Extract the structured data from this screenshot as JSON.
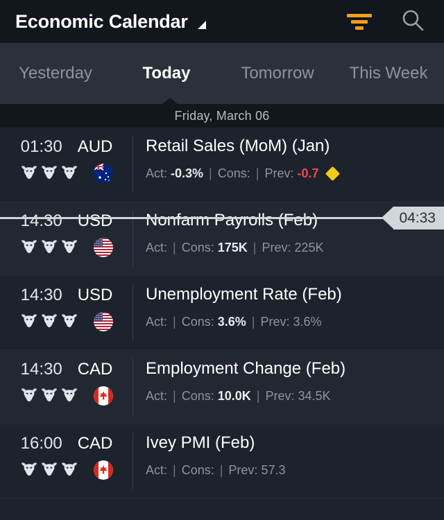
{
  "header": {
    "title": "Economic Calendar",
    "dropdown_icon": "triangle-caret-icon",
    "filter_icon": "filter-icon",
    "search_icon": "search-icon",
    "accent_color": "#f0a020"
  },
  "tabs": [
    {
      "label": "Yesterday",
      "active": false
    },
    {
      "label": "Today",
      "active": true
    },
    {
      "label": "Tomorrow",
      "active": false
    },
    {
      "label": "This Week",
      "active": false
    }
  ],
  "date_band": {
    "label": "Friday, March 06"
  },
  "now_marker": {
    "time": "04:33"
  },
  "labels": {
    "act": "Act:",
    "cons": "Cons:",
    "prev": "Prev:",
    "separator": "|"
  },
  "events": [
    {
      "time": "01:30",
      "currency": "AUD",
      "flag": "flag-australia",
      "impact_icons": 3,
      "title": "Retail Sales (MoM) (Jan)",
      "actual": "-0.3%",
      "actual_state": "normal",
      "consensus": "",
      "previous": "-0.7",
      "previous_state": "negative",
      "badge": "yellow-diamond-icon"
    },
    {
      "time": "14:30",
      "currency": "USD",
      "flag": "flag-usa",
      "impact_icons": 3,
      "title": "Nonfarm Payrolls (Feb)",
      "actual": "",
      "actual_state": "normal",
      "consensus": "175K",
      "previous": "225K",
      "previous_state": "dim",
      "badge": ""
    },
    {
      "time": "14:30",
      "currency": "USD",
      "flag": "flag-usa",
      "impact_icons": 3,
      "title": "Unemployment Rate (Feb)",
      "actual": "",
      "actual_state": "normal",
      "consensus": "3.6%",
      "previous": "3.6%",
      "previous_state": "dim",
      "badge": ""
    },
    {
      "time": "14:30",
      "currency": "CAD",
      "flag": "flag-canada",
      "impact_icons": 3,
      "title": "Employment Change (Feb)",
      "actual": "",
      "actual_state": "normal",
      "consensus": "10.0K",
      "previous": "34.5K",
      "previous_state": "dim",
      "badge": ""
    },
    {
      "time": "16:00",
      "currency": "CAD",
      "flag": "flag-canada",
      "impact_icons": 3,
      "title": "Ivey PMI (Feb)",
      "actual": "",
      "actual_state": "normal",
      "consensus": "",
      "previous": "57.3",
      "previous_state": "dim",
      "badge": ""
    }
  ]
}
